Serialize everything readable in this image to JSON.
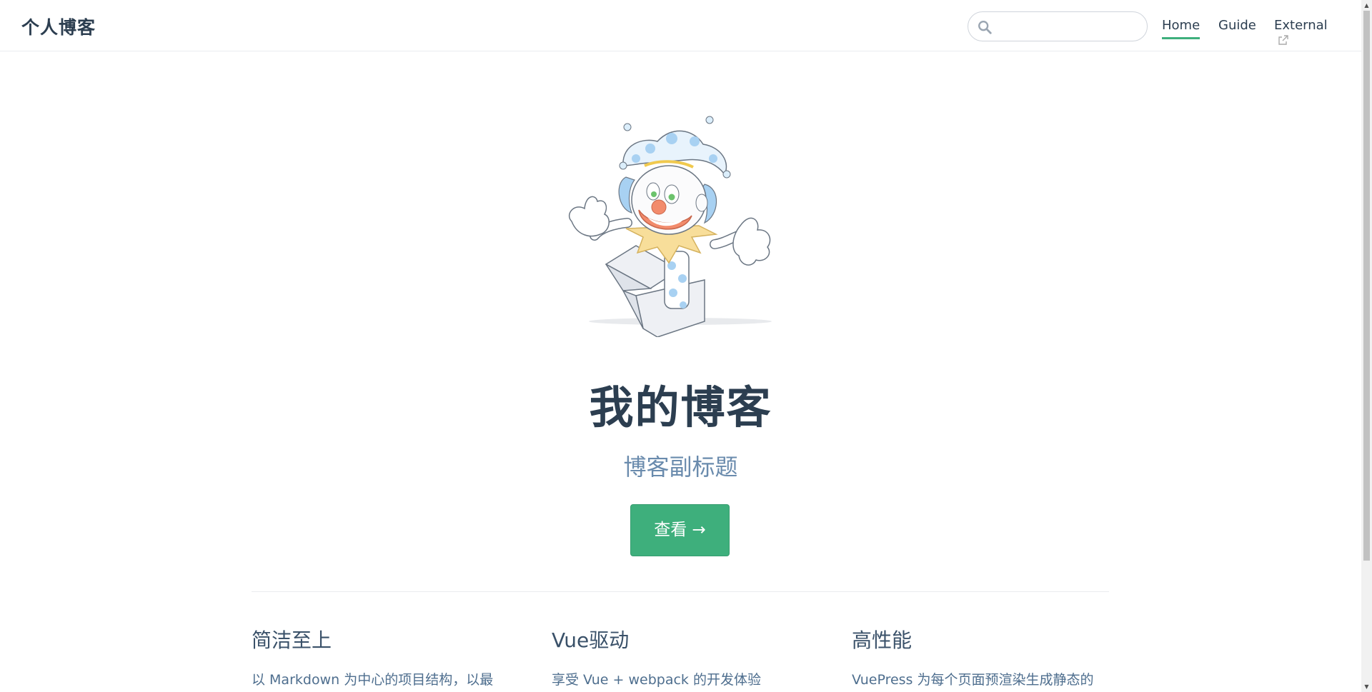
{
  "navbar": {
    "site_name": "个人博客",
    "search": {
      "value": "",
      "placeholder": ""
    },
    "links": [
      {
        "label": "Home",
        "active": true
      },
      {
        "label": "Guide",
        "active": false
      },
      {
        "label": "External",
        "active": false,
        "external": true
      }
    ]
  },
  "hero": {
    "image": "jack-in-the-box-clown-illustration",
    "title": "我的博客",
    "description": "博客副标题",
    "action_label": "查看 →"
  },
  "features": [
    {
      "title": "简洁至上",
      "details": "以 Markdown 为中心的项目结构，以最"
    },
    {
      "title": "Vue驱动",
      "details": "享受 Vue + webpack 的开发体验"
    },
    {
      "title": "高性能",
      "details": "VuePress 为每个页面预渲染生成静态的"
    }
  ],
  "colors": {
    "accent": "#3eaf7c",
    "text": "#2c3e50",
    "description": "#6a8bad"
  }
}
